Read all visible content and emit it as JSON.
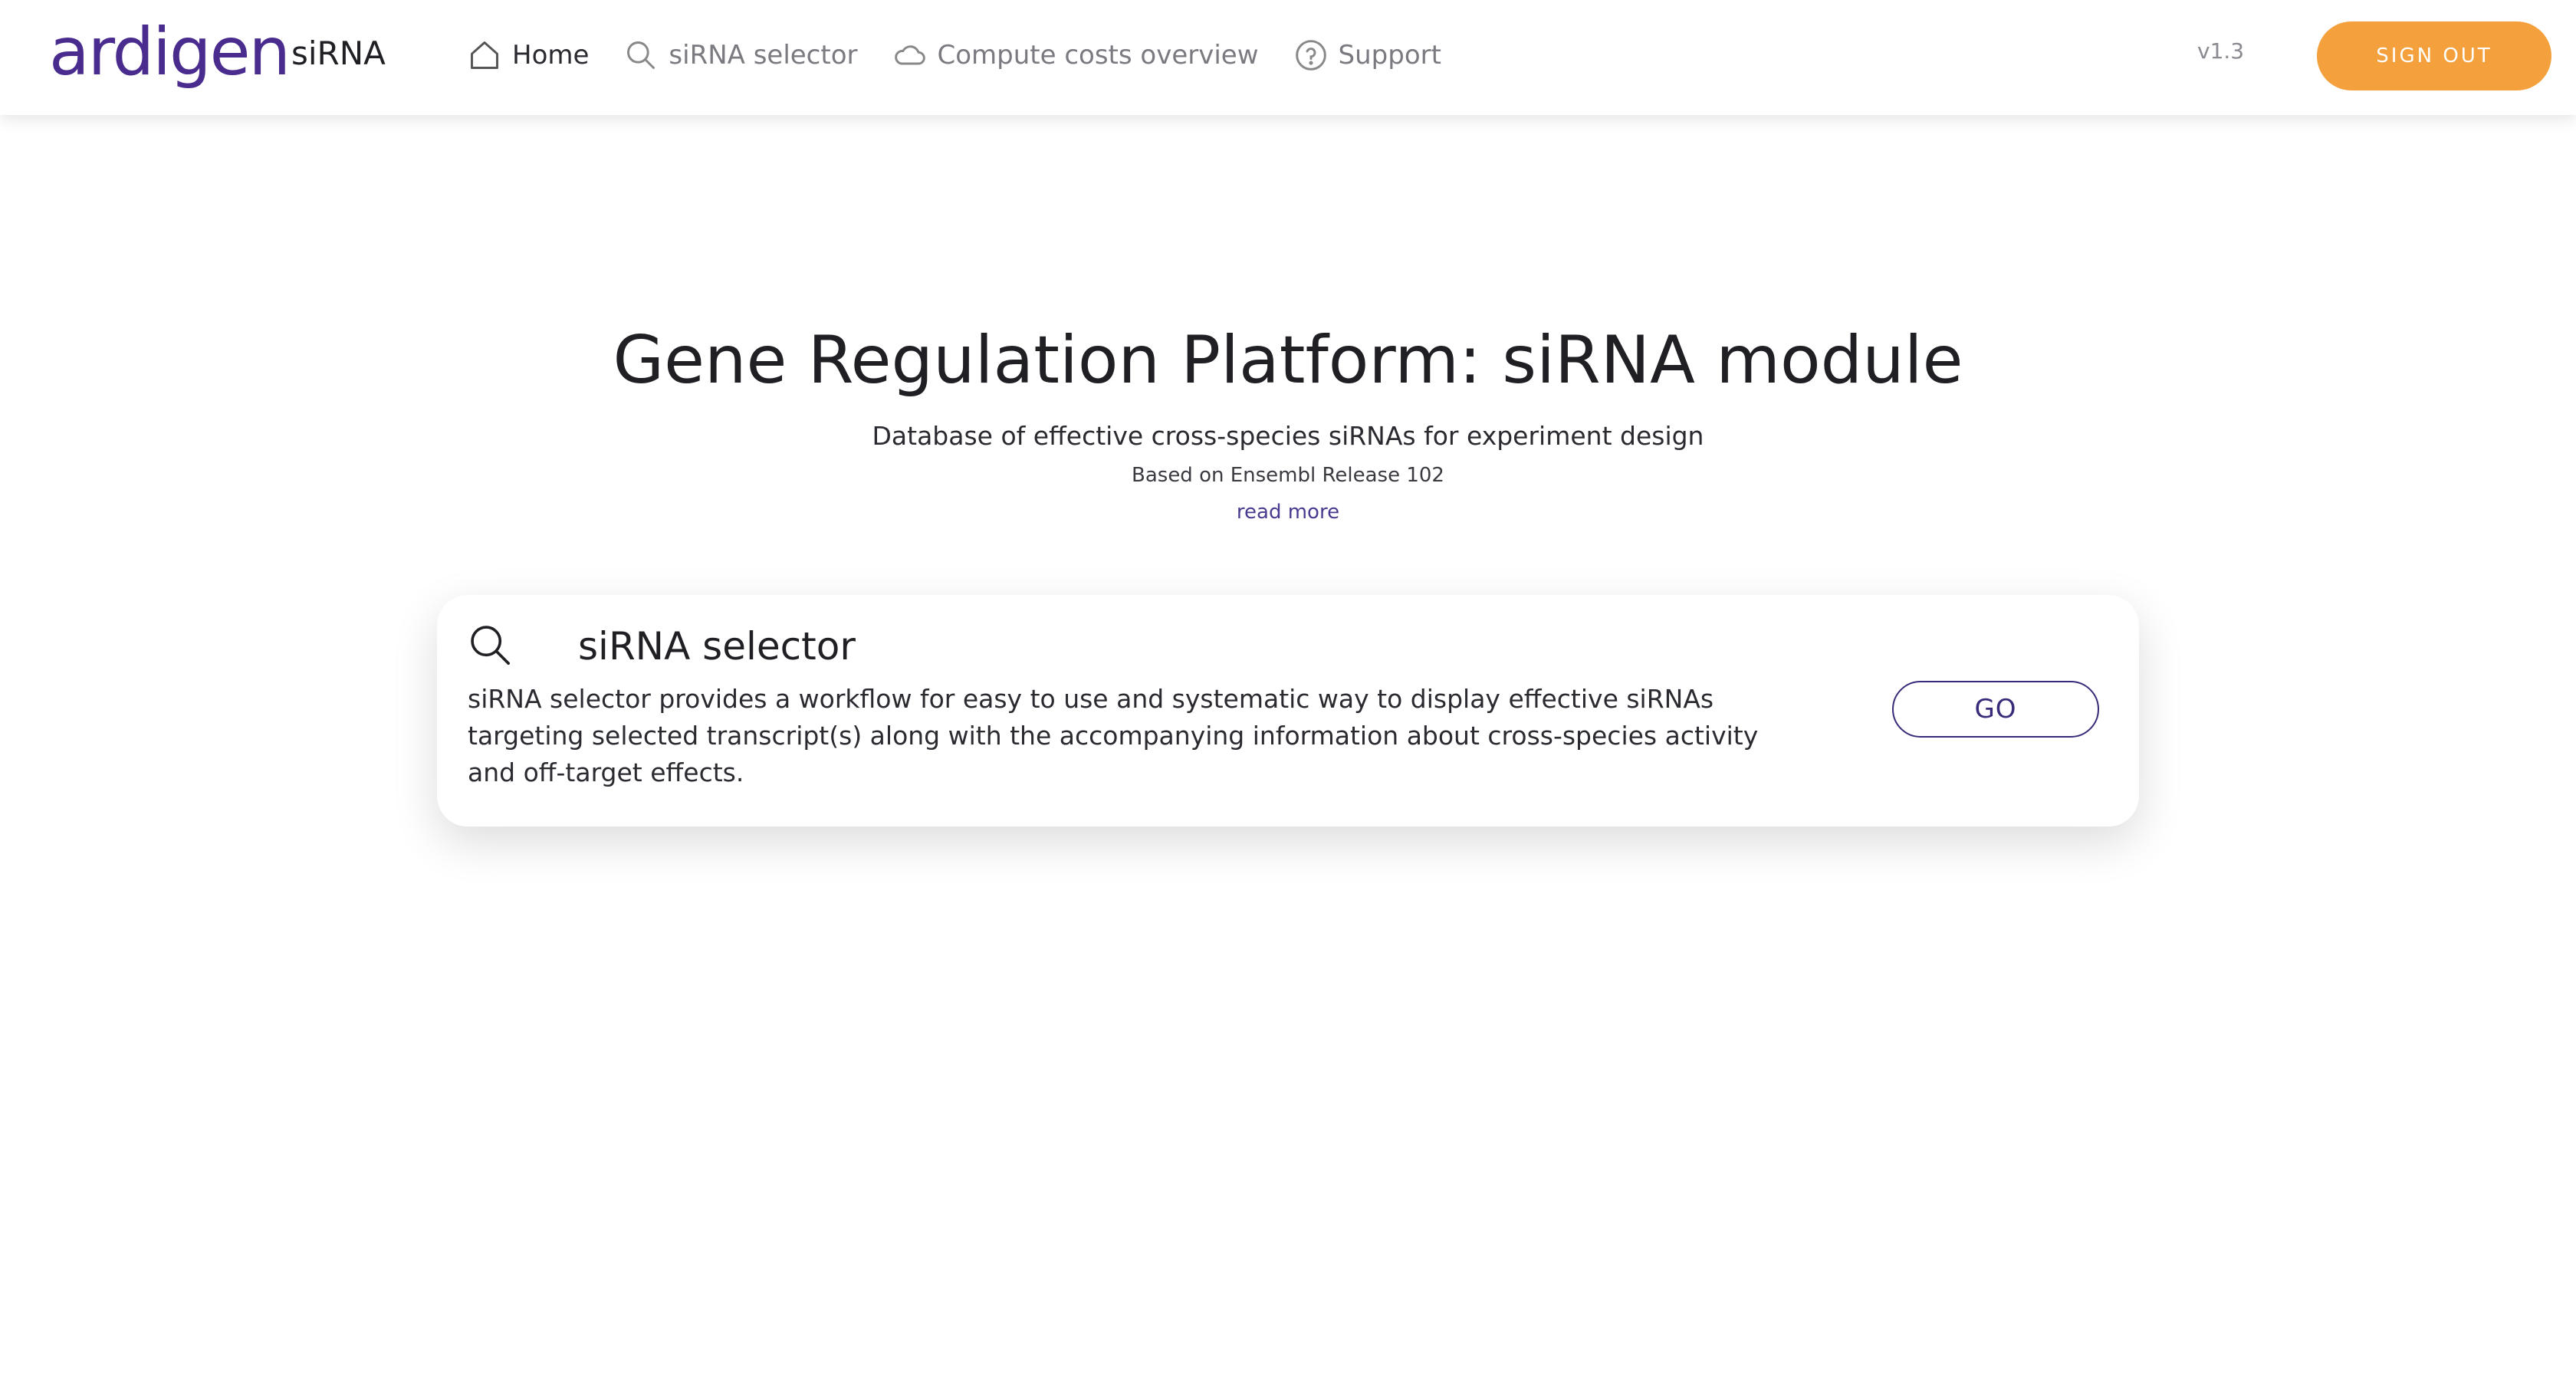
{
  "header": {
    "logo_text": "ardigen",
    "product": "siRNA",
    "nav": [
      {
        "label": "Home",
        "icon": "home-icon",
        "active": true
      },
      {
        "label": "siRNA selector",
        "icon": "search-icon",
        "active": false
      },
      {
        "label": "Compute costs overview",
        "icon": "cloud-icon",
        "active": false
      },
      {
        "label": "Support",
        "icon": "help-circle-icon",
        "active": false
      }
    ],
    "version": "v1.3",
    "signout_label": "SIGN OUT"
  },
  "hero": {
    "title": "Gene Regulation Platform: siRNA module",
    "subtitle": "Database of effective cross-species siRNAs for experiment design",
    "release": "Based on Ensembl Release 102",
    "read_more": "read more"
  },
  "card": {
    "icon": "search-icon",
    "title": "siRNA selector",
    "description": "siRNA selector provides a workflow for easy to use and systematic way to display effective siRNAs targeting selected transcript(s) along with the accompanying information about cross-species activity and off-target effects.",
    "button_label": "GO"
  },
  "colors": {
    "brand_purple": "#4a2c8f",
    "accent_orange": "#f4a13d",
    "button_outline": "#3a2a7a"
  }
}
